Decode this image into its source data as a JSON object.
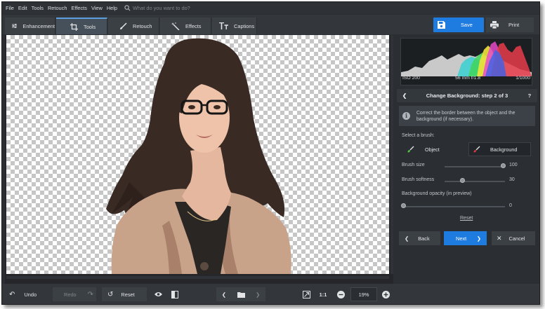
{
  "menu": [
    "File",
    "Edit",
    "Tools",
    "Retouch",
    "Effects",
    "View",
    "Help"
  ],
  "search": {
    "placeholder": "What do you want to do?"
  },
  "tabs": [
    {
      "label": "Enhancement",
      "icon": "sliders-icon"
    },
    {
      "label": "Tools",
      "icon": "crop-icon"
    },
    {
      "label": "Retouch",
      "icon": "brush-icon"
    },
    {
      "label": "Effects",
      "icon": "magic-wand-icon"
    },
    {
      "label": "Captions",
      "icon": "text-icon"
    }
  ],
  "active_tab": "Tools",
  "header_buttons": {
    "save": "Save",
    "print": "Print"
  },
  "exif": {
    "iso": "ISO 200",
    "lens": "56 mm f/1.8",
    "shutter": "1/1000"
  },
  "step": {
    "title": "Change Background: step 2 of 3",
    "help": "?",
    "info": "Correct the border between the object and the background (if necessary)."
  },
  "brush": {
    "label": "Select a brush:",
    "object": "Object",
    "background": "Background",
    "selected": "Background"
  },
  "sliders": {
    "size": {
      "label": "Brush size",
      "value": "100",
      "fraction": 1.0
    },
    "softness": {
      "label": "Brush softness",
      "value": "30",
      "fraction": 0.3
    },
    "opacity": {
      "label": "Background opacity (in preview)",
      "value": "0",
      "fraction": 0.0
    }
  },
  "reset_link": "Reset",
  "nav": {
    "back": "Back",
    "next": "Next",
    "cancel": "Cancel"
  },
  "bottom": {
    "undo": "Undo",
    "redo": "Redo",
    "reset": "Reset",
    "one_to_one": "1:1",
    "zoom": "19%"
  },
  "colors": {
    "accent": "#1e7be0",
    "panel": "#2b2f33",
    "bar": "#33373b"
  }
}
